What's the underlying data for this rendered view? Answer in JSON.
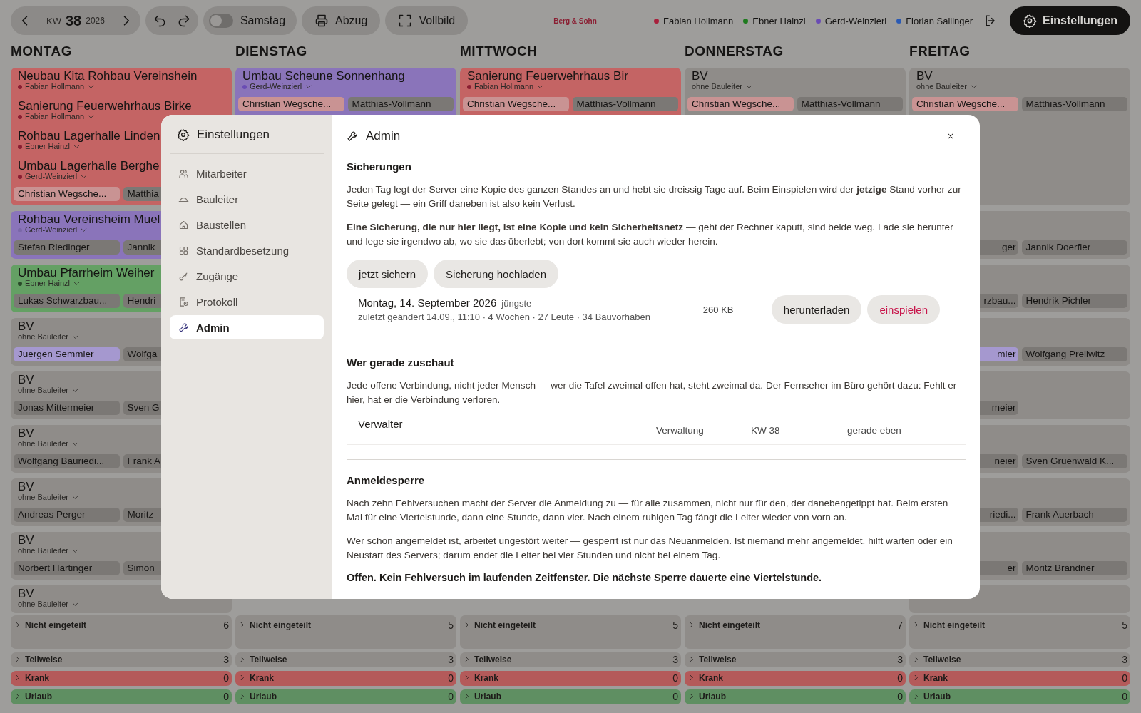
{
  "toolbar": {
    "week_label": "KW",
    "week": "38",
    "year": "2026",
    "saturday": {
      "label": "Samstag",
      "on": false
    },
    "buttons": [
      {
        "kind": "print",
        "label": "Abzug"
      },
      {
        "kind": "fullscreen",
        "label": "Vollbild"
      }
    ],
    "logo": "Berg & Sohn",
    "leaders": [
      {
        "name": "Fabian Hollmann",
        "color": "#a8203c"
      },
      {
        "name": "Ebner Hainzl",
        "color": "#1e7a1e"
      },
      {
        "name": "Gerd-Weinzierl",
        "color": "#6a4cb4"
      },
      {
        "name": "Florian Sallinger",
        "color": "#2a5ab4"
      }
    ],
    "settings_button": "Einstellungen"
  },
  "days": [
    {
      "name": "MONTAG",
      "cards": [
        {
          "color": "#c46464",
          "projects": [
            {
              "title": "Neubau Kita Rohbau Vereinshein",
              "leader": "Fabian Hollmann",
              "color": "#8a1e32"
            },
            {
              "title": "Sanierung Feuerwehrhaus Birke",
              "leader": "Fabian Hollmann",
              "color": "#8a1e32"
            },
            {
              "title": "Rohbau Lagerhalle Linden",
              "leader": "Ebner Hainzl",
              "color": "#8a1e32"
            },
            {
              "title": "Umbau Lagerhalle Berghe",
              "leader": "Gerd-Weinzierl",
              "color": "#8a1e32"
            }
          ],
          "chips": [
            {
              "name": "Christian Wegsche...",
              "color": "#c99393"
            },
            {
              "name": "Matthia"
            }
          ]
        },
        {
          "color": "#8a74ba",
          "projects": [
            {
              "title": "Rohbau Vereinsheim Muel",
              "leader": "Gerd-Weinzierl",
              "color": "#7a68a8"
            }
          ],
          "chips": [
            {
              "name": "Stefan Riedinger"
            },
            {
              "name": "Jannik"
            }
          ]
        },
        {
          "color": "#64a064",
          "projects": [
            {
              "title": "Umbau Pfarrheim Weiher",
              "leader": "Ebner Hainzl",
              "color": "#2a4a2a"
            }
          ],
          "chips": [
            {
              "name": "Lukas Schwarzbau..."
            },
            {
              "name": "Hendri"
            }
          ]
        },
        {
          "color": "#8f8c89",
          "projects": [
            {
              "title": "BV",
              "leader": "ohne Bauleiter"
            }
          ],
          "chips": [
            {
              "name": "Juergen Semmler",
              "color": "#a598cf"
            },
            {
              "name": "Wolfga"
            }
          ]
        },
        {
          "color": "#8f8c89",
          "projects": [
            {
              "title": "BV",
              "leader": "ohne Bauleiter"
            }
          ],
          "chips": [
            {
              "name": "Jonas Mittermeier"
            },
            {
              "name": "Sven G"
            }
          ]
        },
        {
          "color": "#8f8c89",
          "projects": [
            {
              "title": "BV",
              "leader": "ohne Bauleiter"
            }
          ],
          "chips": [
            {
              "name": "Wolfgang Bauriedi..."
            },
            {
              "name": "Frank A"
            }
          ]
        },
        {
          "color": "#8f8c89",
          "projects": [
            {
              "title": "BV",
              "leader": "ohne Bauleiter"
            }
          ],
          "chips": [
            {
              "name": "Andreas Perger"
            },
            {
              "name": "Moritz"
            }
          ]
        },
        {
          "color": "#8f8c89",
          "projects": [
            {
              "title": "BV",
              "leader": "ohne Bauleiter"
            }
          ],
          "chips": [
            {
              "name": "Norbert Hartinger"
            },
            {
              "name": "Simon"
            }
          ]
        },
        {
          "color": "#8f8c89",
          "projects": [
            {
              "title": "BV",
              "leader": "ohne Bauleiter"
            }
          ]
        }
      ],
      "summary": [
        {
          "label": "Nicht eingeteilt",
          "count": "6",
          "kind": "unassigned"
        },
        {
          "label": "Teilweise",
          "count": "3",
          "kind": "partial"
        },
        {
          "label": "Krank",
          "count": "0",
          "kind": "sick"
        },
        {
          "label": "Urlaub",
          "count": "0",
          "kind": "vacation"
        }
      ]
    },
    {
      "name": "DIENSTAG",
      "cards": [
        {
          "color": "#8a74ba",
          "projects": [
            {
              "title": "Umbau Scheune Sonnenhang",
              "leader": "Gerd-Weinzierl",
              "color": "#6a4cb4"
            }
          ],
          "chips": [
            {
              "name": "Christian Wegsche...",
              "color": "#c99393"
            },
            {
              "name": "Matthias-Vollmann"
            }
          ]
        }
      ],
      "summary": [
        {
          "label": "Nicht eingeteilt",
          "count": "5",
          "kind": "unassigned"
        },
        {
          "label": "Teilweise",
          "count": "3",
          "kind": "partial"
        },
        {
          "label": "Krank",
          "count": "0",
          "kind": "sick"
        },
        {
          "label": "Urlaub",
          "count": "0",
          "kind": "vacation"
        }
      ]
    },
    {
      "name": "MITTWOCH",
      "cards": [
        {
          "color": "#c46464",
          "projects": [
            {
              "title": "Sanierung Feuerwehrhaus Bir",
              "leader": "Fabian Hollmann",
              "color": "#8a1e32"
            }
          ],
          "chips": [
            {
              "name": "Christian Wegsche...",
              "color": "#c99393"
            },
            {
              "name": "Matthias-Vollmann"
            }
          ]
        }
      ],
      "summary": [
        {
          "label": "Nicht eingeteilt",
          "count": "5",
          "kind": "unassigned"
        },
        {
          "label": "Teilweise",
          "count": "3",
          "kind": "partial"
        },
        {
          "label": "Krank",
          "count": "0",
          "kind": "sick"
        },
        {
          "label": "Urlaub",
          "count": "0",
          "kind": "vacation"
        }
      ]
    },
    {
      "name": "DONNERSTAG",
      "cards": [
        {
          "color": "#8f8c89",
          "projects": [
            {
              "title": "BV",
              "leader": "ohne Bauleiter"
            }
          ],
          "chips": [
            {
              "name": "Christian Wegsche...",
              "color": "#c99393"
            },
            {
              "name": "Matthias-Vollmann"
            }
          ]
        }
      ],
      "summary": [
        {
          "label": "Nicht eingeteilt",
          "count": "7",
          "kind": "unassigned"
        },
        {
          "label": "Teilweise",
          "count": "3",
          "kind": "partial"
        },
        {
          "label": "Krank",
          "count": "0",
          "kind": "sick"
        },
        {
          "label": "Urlaub",
          "count": "0",
          "kind": "vacation"
        }
      ]
    },
    {
      "name": "FREITAG",
      "cards": [
        {
          "color": "#8f8c89",
          "projects": [
            {
              "title": "BV",
              "leader": "ohne Bauleiter"
            }
          ],
          "chips": [
            {
              "name": "Christian Wegsche...",
              "color": "#c99393"
            },
            {
              "name": "Matthias-Vollmann"
            }
          ]
        },
        {
          "color": "#8f8c89",
          "chips": [
            {
              "name": "ger"
            },
            {
              "name": "Jannik Doerfler"
            }
          ]
        },
        {
          "color": "#8f8c89",
          "chips": [
            {
              "name": "rzbau..."
            },
            {
              "name": "Hendrik Pichler"
            }
          ]
        },
        {
          "color": "#8f8c89",
          "chips": [
            {
              "name": "mler",
              "color": "#a598cf"
            },
            {
              "name": "Wolfgang Prellwitz"
            }
          ]
        },
        {
          "color": "#8f8c89",
          "chips": [
            {
              "name": "meier"
            }
          ]
        },
        {
          "color": "#8f8c89",
          "chips": [
            {
              "name": "neier"
            },
            {
              "name": "Sven Gruenwald K..."
            }
          ]
        },
        {
          "color": "#8f8c89",
          "chips": [
            {
              "name": "riedi..."
            },
            {
              "name": "Frank Auerbach"
            }
          ]
        },
        {
          "color": "#8f8c89",
          "chips": [
            {
              "name": "er"
            },
            {
              "name": "Moritz Brandner"
            }
          ]
        },
        {
          "color": "#8f8c89"
        }
      ],
      "summary": [
        {
          "label": "Nicht eingeteilt",
          "count": "5",
          "kind": "unassigned"
        },
        {
          "label": "Teilweise",
          "count": "3",
          "kind": "partial"
        },
        {
          "label": "Krank",
          "count": "0",
          "kind": "sick"
        },
        {
          "label": "Urlaub",
          "count": "0",
          "kind": "vacation"
        }
      ]
    }
  ],
  "modal": {
    "title": "Einstellungen",
    "nav": [
      {
        "kind": "people",
        "label": "Mitarbeiter",
        "selected": false
      },
      {
        "kind": "hardhat",
        "label": "Bauleiter",
        "selected": false
      },
      {
        "kind": "house",
        "label": "Baustellen",
        "selected": false
      },
      {
        "kind": "grid",
        "label": "Standardbesetzung",
        "selected": false
      },
      {
        "kind": "key",
        "label": "Zugänge",
        "selected": false
      },
      {
        "kind": "log",
        "label": "Protokoll",
        "selected": false
      },
      {
        "kind": "wrench",
        "label": "Admin",
        "selected": true
      }
    ],
    "page_title": "Admin",
    "sections": [
      {
        "heading": "Sicherungen",
        "paragraphs": [
          "Jeden Tag legt der Server eine Kopie des ganzen Standes an und hebt sie dreissig Tage auf. Beim Einspielen wird der **jetzige** Stand vorher zur Seite gelegt — ein Griff daneben ist also kein Verlust.",
          "**Eine Sicherung, die nur hier liegt, ist eine Kopie und kein Sicherheitsnetz** — geht der Rechner kaputt, sind beide weg. Lade sie herunter und lege sie irgendwo ab, wo sie das überlebt; von dort kommt sie auch wieder herein."
        ],
        "actions": [
          "jetzt sichern",
          "Sicherung hochladen"
        ],
        "backups": [
          {
            "date": "Montag, 14. September 2026",
            "tag": "jüngste",
            "meta": "zuletzt geändert 14.09., 11:10 · 4 Wochen · 27 Leute · 34 Bauvorhaben",
            "size": "260 KB",
            "download": "herunterladen",
            "restore": "einspielen"
          }
        ]
      },
      {
        "heading": "Wer gerade zuschaut",
        "paragraphs": [
          "Jede offene Verbindung, nicht jeder Mensch — wer die Tafel zweimal offen hat, steht zweimal da. Der Fernseher im Büro gehört dazu: Fehlt er hier, hat er die Verbindung verloren."
        ],
        "viewers": [
          {
            "name": "Verwalter",
            "role": "Verwaltung",
            "week": "KW 38",
            "seen": "gerade eben"
          }
        ]
      },
      {
        "heading": "Anmeldesperre",
        "paragraphs": [
          "Nach zehn Fehlversuchen macht der Server die Anmeldung zu — für alle zusammen, nicht nur für den, der danebengetippt hat. Beim ersten Mal für eine Viertelstunde, dann eine Stunde, dann vier. Nach einem ruhigen Tag fängt die Leiter wieder von vorn an.",
          "Wer schon angemeldet ist, arbeitet ungestört weiter — gesperrt ist nur das Neuanmelden. Ist niemand mehr angemeldet, hilft warten oder ein Neustart des Servers; darum endet die Leiter bei vier Stunden und nicht bei einem Tag."
        ],
        "status": "Offen. Kein Fehlversuch im laufenden Zeitfenster. Die nächste Sperre dauerte eine Viertelstunde."
      }
    ]
  }
}
